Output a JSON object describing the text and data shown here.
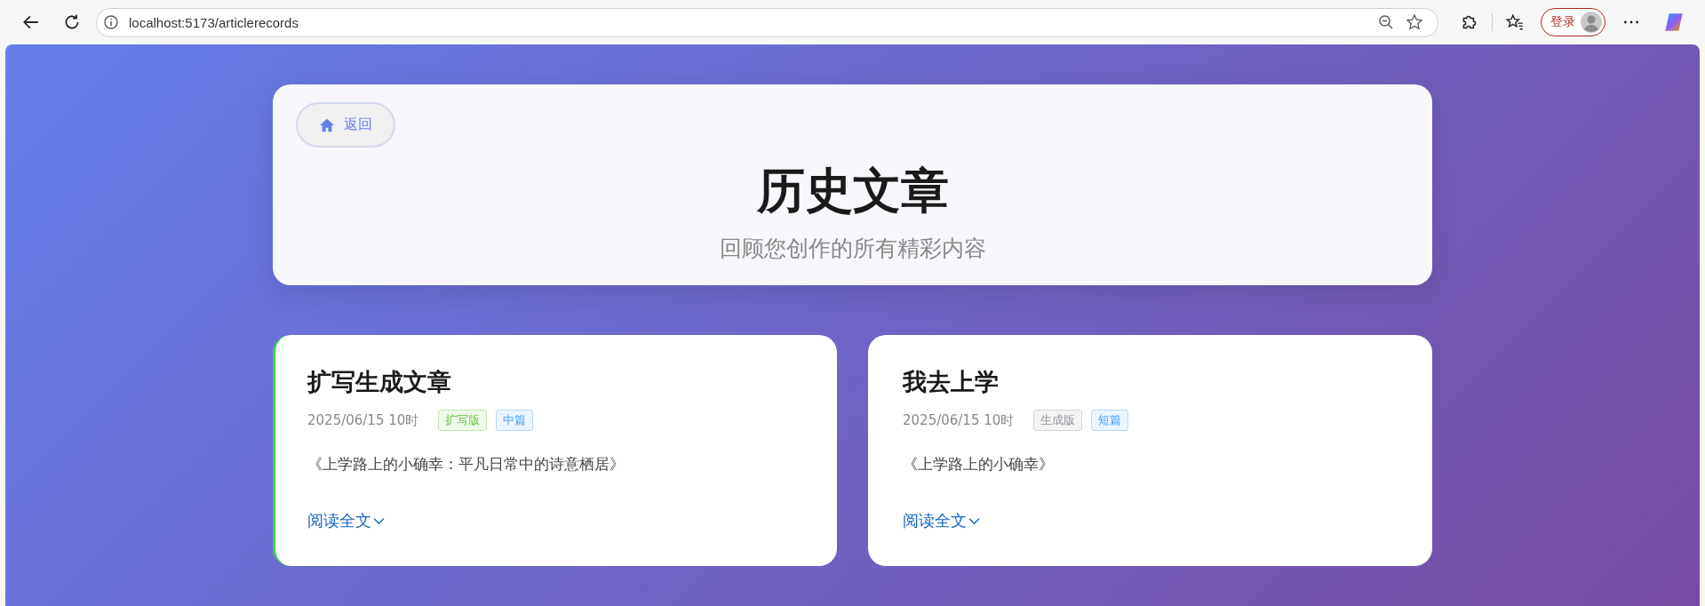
{
  "browser": {
    "url": "localhost:5173/articlerecords",
    "login_label": "登录"
  },
  "header": {
    "back_label": "返回",
    "title": "历史文章",
    "subtitle": "回顾您创作的所有精彩内容"
  },
  "articles": [
    {
      "title": "扩写生成文章",
      "date": "2025/06/15 10时",
      "selected": true,
      "tags": [
        {
          "label": "扩写版",
          "color": "#67c23a"
        },
        {
          "label": "中篇",
          "color": "#409eff"
        }
      ],
      "excerpt": "《上学路上的小确幸：平凡日常中的诗意栖居》",
      "read_more": "阅读全文"
    },
    {
      "title": "我去上学",
      "date": "2025/06/15 10时",
      "selected": false,
      "tags": [
        {
          "label": "生成版",
          "color": "#909399"
        },
        {
          "label": "短篇",
          "color": "#409eff"
        }
      ],
      "excerpt": "《上学路上的小确幸》",
      "read_more": "阅读全文"
    }
  ]
}
